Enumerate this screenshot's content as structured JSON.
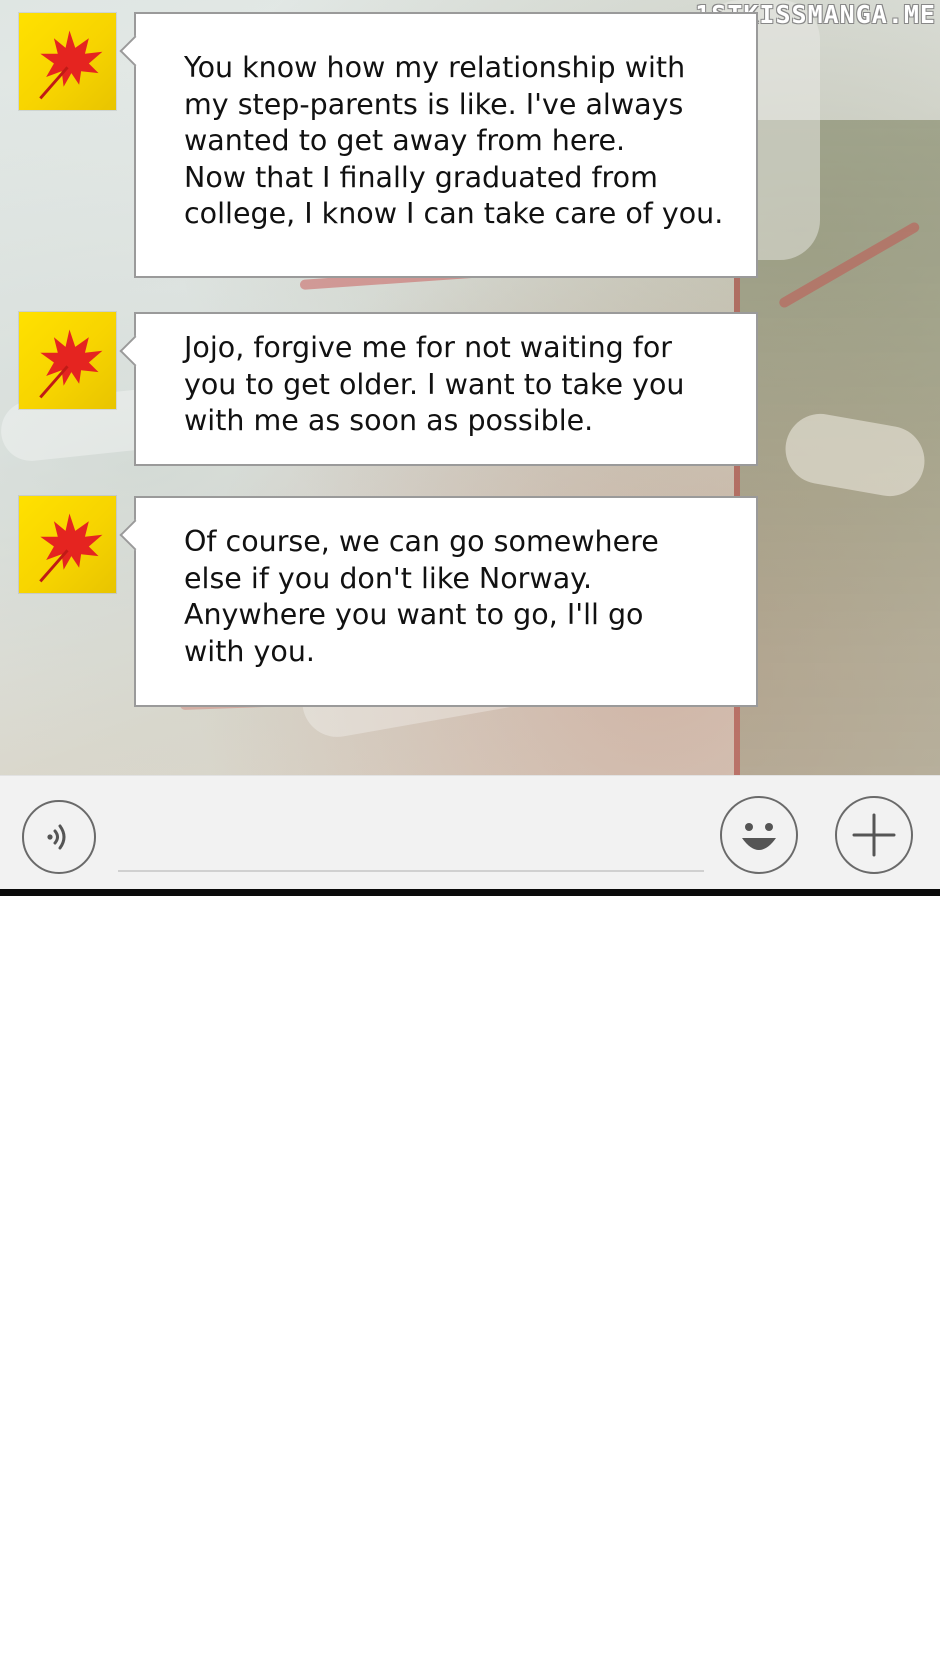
{
  "watermark": "1STKISSMANGA.ME",
  "messages": [
    {
      "avatar_icon": "maple-leaf-icon",
      "text": "You know how my relationship with\nmy step-parents is like. I've always\nwanted to get away from here.\nNow that I finally graduated from\ncollege, I know I can take care of you."
    },
    {
      "avatar_icon": "maple-leaf-icon",
      "text": "Jojo, forgive me for not waiting for\nyou to get older. I want to take you\nwith me as soon as possible."
    },
    {
      "avatar_icon": "maple-leaf-icon",
      "text": "Of course, we can go somewhere\nelse if you don't like Norway.\nAnywhere you want to go, I'll go\nwith you."
    }
  ],
  "input_bar": {
    "voice_icon": "voice-icon",
    "input_value": "",
    "emoji_icon": "smiley-icon",
    "add_icon": "plus-icon"
  },
  "colors": {
    "avatar_bg": "#f7d400",
    "leaf": "#e52420",
    "bubble_border": "#9a9a9a",
    "input_bar_bg": "#f2f2f2"
  }
}
